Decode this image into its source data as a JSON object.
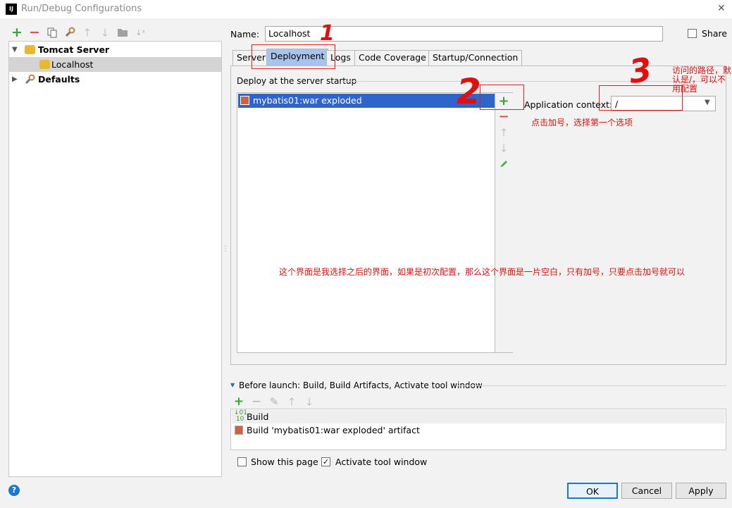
{
  "window": {
    "title": "Run/Debug Configurations",
    "app_icon": "IJ",
    "close_glyph": "✕"
  },
  "toolbar": {
    "icons": [
      "add-icon",
      "remove-icon",
      "copy-icon",
      "wrench-icon",
      "move-up-icon",
      "move-down-icon",
      "folder-icon",
      "sort-icon"
    ]
  },
  "tree": {
    "items": [
      {
        "label": "Tomcat Server",
        "bold": true,
        "expanded": true
      },
      {
        "label": "Localhost",
        "bold": false,
        "selected": true
      },
      {
        "label": "Defaults",
        "bold": true,
        "expanded": false
      }
    ]
  },
  "name_field": {
    "label": "Name:",
    "value": "Localhost"
  },
  "share": {
    "label": "Share",
    "checked": false
  },
  "tabs": [
    {
      "label": "Server",
      "active": false
    },
    {
      "label": "Deployment",
      "active": true
    },
    {
      "label": "Logs",
      "active": false
    },
    {
      "label": "Code Coverage",
      "active": false
    },
    {
      "label": "Startup/Connection",
      "active": false
    }
  ],
  "deployment": {
    "section_label": "Deploy at the server startup",
    "artifacts": [
      "mybatis01:war exploded"
    ],
    "app_context_label": "Application context:",
    "app_context_value": "/"
  },
  "before_launch": {
    "label": "Before launch: Build, Build Artifacts, Activate tool window",
    "items": [
      "Build",
      "Build 'mybatis01:war exploded' artifact"
    ]
  },
  "options": {
    "show_page": {
      "label": "Show this page",
      "checked": false
    },
    "activate_tool": {
      "label": "Activate tool window",
      "checked": true
    }
  },
  "buttons": {
    "ok": "OK",
    "cancel": "Cancel",
    "apply": "Apply",
    "help": "?"
  },
  "annotations": {
    "num1": "1",
    "num2": "2",
    "num3": "3",
    "note_path": "访问的路径，默认是/，可以不用配置",
    "note_plus": "点击加号，选择第一个选项",
    "note_main": "这个界面是我选择之后的界面，如果是初次配置，那么这个界面是一片空白，只有加号，只要点击加号就可以"
  },
  "colors": {
    "accent": "#1979ca",
    "selection": "#d4d4d4",
    "annotation": "#e01010",
    "active_tab": "#a8c4ea"
  }
}
